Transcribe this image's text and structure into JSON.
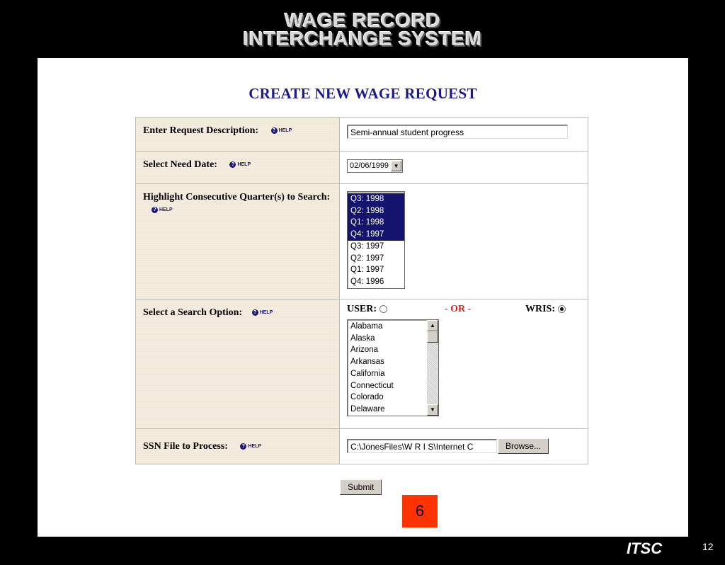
{
  "banner": {
    "line1": "WAGE RECORD",
    "line2": "INTERCHANGE SYSTEM"
  },
  "title": "CREATE NEW WAGE REQUEST",
  "help_label": "HELP",
  "rows": {
    "description": {
      "label": "Enter Request Description:",
      "value": "Semi-annual student progress"
    },
    "need_date": {
      "label": "Select Need Date:",
      "selected": "02/06/1999"
    },
    "quarters": {
      "label": "Highlight Consecutive Quarter(s) to Search:",
      "options": [
        {
          "label": "Q3: 1998",
          "selected": true
        },
        {
          "label": "Q2: 1998",
          "selected": true
        },
        {
          "label": "Q1: 1998",
          "selected": true
        },
        {
          "label": "Q4: 1997",
          "selected": true
        },
        {
          "label": "Q3: 1997",
          "selected": false
        },
        {
          "label": "Q2: 1997",
          "selected": false
        },
        {
          "label": "Q1: 1997",
          "selected": false
        },
        {
          "label": "Q4: 1996",
          "selected": false
        }
      ]
    },
    "search_option": {
      "label": "Select a Search Option:",
      "user_label": "USER:",
      "user_checked": false,
      "or_label": "- OR -",
      "wris_label": "WRIS:",
      "wris_checked": true,
      "states": [
        "Alabama",
        "Alaska",
        "Arizona",
        "Arkansas",
        "California",
        "Connecticut",
        "Colorado",
        "Delaware"
      ]
    },
    "ssn_file": {
      "label": "SSN File to Process:",
      "value": "C:\\JonesFiles\\W R I S\\Internet C",
      "browse_label": "Browse..."
    }
  },
  "submit_label": "Submit",
  "step_badge": "6",
  "footer": {
    "brand": "ITSC",
    "page": "12"
  },
  "colors": {
    "title": "#1a1a8c",
    "selection": "#14146e",
    "badge": "#ff3300",
    "or": "#e0201b"
  }
}
